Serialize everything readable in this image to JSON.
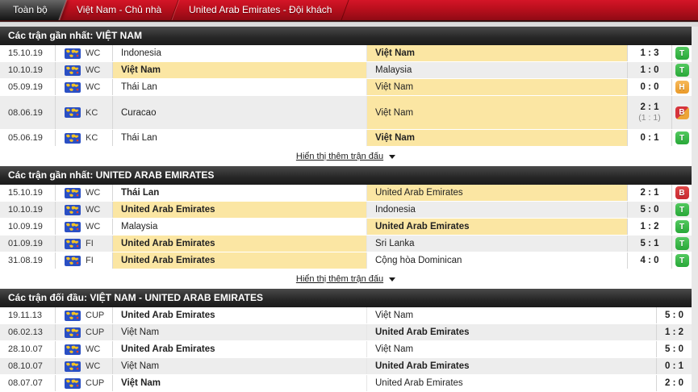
{
  "tabs": [
    {
      "label": "Toàn bộ",
      "active": true
    },
    {
      "label": "Việt Nam - Chủ nhà",
      "active": false
    },
    {
      "label": "United Arab Emirates - Đội khách",
      "active": false
    }
  ],
  "sections": [
    {
      "title": "Các trận gần nhất: VIỆT NAM",
      "has_badge_col": true,
      "show_more": "Hiển thị thêm trận đấu",
      "rows": [
        {
          "date": "15.10.19",
          "comp": "WC",
          "home": {
            "name": "Indonesia",
            "bold": false,
            "hl": false
          },
          "away": {
            "name": "Việt Nam",
            "bold": true,
            "hl": true
          },
          "score": "1 : 3",
          "score_sub": "",
          "badge": "T",
          "badge_style": "win"
        },
        {
          "date": "10.10.19",
          "comp": "WC",
          "home": {
            "name": "Việt Nam",
            "bold": true,
            "hl": true
          },
          "away": {
            "name": "Malaysia",
            "bold": false,
            "hl": false
          },
          "score": "1 : 0",
          "score_sub": "",
          "badge": "T",
          "badge_style": "win"
        },
        {
          "date": "05.09.19",
          "comp": "WC",
          "home": {
            "name": "Thái Lan",
            "bold": false,
            "hl": false
          },
          "away": {
            "name": "Việt Nam",
            "bold": false,
            "hl": true
          },
          "score": "0 : 0",
          "score_sub": "",
          "badge": "H",
          "badge_style": "draw"
        },
        {
          "date": "08.06.19",
          "comp": "KC",
          "home": {
            "name": "Curacao",
            "bold": false,
            "hl": false
          },
          "away": {
            "name": "Việt Nam",
            "bold": false,
            "hl": true
          },
          "score": "2 : 1",
          "score_sub": "(1 : 1)",
          "badge": "B",
          "badge_style": "loss-pen"
        },
        {
          "date": "05.06.19",
          "comp": "KC",
          "home": {
            "name": "Thái Lan",
            "bold": false,
            "hl": false
          },
          "away": {
            "name": "Việt Nam",
            "bold": true,
            "hl": true
          },
          "score": "0 : 1",
          "score_sub": "",
          "badge": "T",
          "badge_style": "win"
        }
      ]
    },
    {
      "title": "Các trận gần nhất: UNITED ARAB EMIRATES",
      "has_badge_col": true,
      "show_more": "Hiển thị thêm trận đấu",
      "rows": [
        {
          "date": "15.10.19",
          "comp": "WC",
          "home": {
            "name": "Thái Lan",
            "bold": true,
            "hl": false
          },
          "away": {
            "name": "United Arab Emirates",
            "bold": false,
            "hl": true
          },
          "score": "2 : 1",
          "score_sub": "",
          "badge": "B",
          "badge_style": "loss"
        },
        {
          "date": "10.10.19",
          "comp": "WC",
          "home": {
            "name": "United Arab Emirates",
            "bold": true,
            "hl": true
          },
          "away": {
            "name": "Indonesia",
            "bold": false,
            "hl": false
          },
          "score": "5 : 0",
          "score_sub": "",
          "badge": "T",
          "badge_style": "win"
        },
        {
          "date": "10.09.19",
          "comp": "WC",
          "home": {
            "name": "Malaysia",
            "bold": false,
            "hl": false
          },
          "away": {
            "name": "United Arab Emirates",
            "bold": true,
            "hl": true
          },
          "score": "1 : 2",
          "score_sub": "",
          "badge": "T",
          "badge_style": "win"
        },
        {
          "date": "01.09.19",
          "comp": "FI",
          "home": {
            "name": "United Arab Emirates",
            "bold": true,
            "hl": true
          },
          "away": {
            "name": "Sri Lanka",
            "bold": false,
            "hl": false
          },
          "score": "5 : 1",
          "score_sub": "",
          "badge": "T",
          "badge_style": "win"
        },
        {
          "date": "31.08.19",
          "comp": "FI",
          "home": {
            "name": "United Arab Emirates",
            "bold": true,
            "hl": true
          },
          "away": {
            "name": "Cộng hòa Dominican",
            "bold": false,
            "hl": false
          },
          "score": "4 : 0",
          "score_sub": "",
          "badge": "T",
          "badge_style": "win"
        }
      ]
    },
    {
      "title": "Các trận đối đầu: VIỆT NAM - UNITED ARAB EMIRATES",
      "has_badge_col": false,
      "show_more": "",
      "rows": [
        {
          "date": "19.11.13",
          "comp": "CUP",
          "home": {
            "name": "United Arab Emirates",
            "bold": true,
            "hl": false
          },
          "away": {
            "name": "Việt Nam",
            "bold": false,
            "hl": false
          },
          "score": "5 : 0",
          "score_sub": ""
        },
        {
          "date": "06.02.13",
          "comp": "CUP",
          "home": {
            "name": "Việt Nam",
            "bold": false,
            "hl": false
          },
          "away": {
            "name": "United Arab Emirates",
            "bold": true,
            "hl": false
          },
          "score": "1 : 2",
          "score_sub": ""
        },
        {
          "date": "28.10.07",
          "comp": "WC",
          "home": {
            "name": "United Arab Emirates",
            "bold": true,
            "hl": false
          },
          "away": {
            "name": "Việt Nam",
            "bold": false,
            "hl": false
          },
          "score": "5 : 0",
          "score_sub": ""
        },
        {
          "date": "08.10.07",
          "comp": "WC",
          "home": {
            "name": "Việt Nam",
            "bold": false,
            "hl": false
          },
          "away": {
            "name": "United Arab Emirates",
            "bold": true,
            "hl": false
          },
          "score": "0 : 1",
          "score_sub": ""
        },
        {
          "date": "08.07.07",
          "comp": "CUP",
          "home": {
            "name": "Việt Nam",
            "bold": true,
            "hl": false
          },
          "away": {
            "name": "United Arab Emirates",
            "bold": false,
            "hl": false
          },
          "score": "2 : 0",
          "score_sub": ""
        }
      ]
    }
  ],
  "legend": {
    "win_letter": "T",
    "draw_letter": "H",
    "loss_letter": "B"
  },
  "colors": {
    "accent_red_top": "#d41527",
    "win_green": "#28a838",
    "draw_orange": "#eb9a28",
    "loss_red": "#c82830",
    "loss_penalty_orange": "#eda437",
    "team_highlight_yellow": "#fbe6a3"
  },
  "icons": {
    "competition": "world-map-icon",
    "show_more_arrow": "chevron-down-icon"
  }
}
